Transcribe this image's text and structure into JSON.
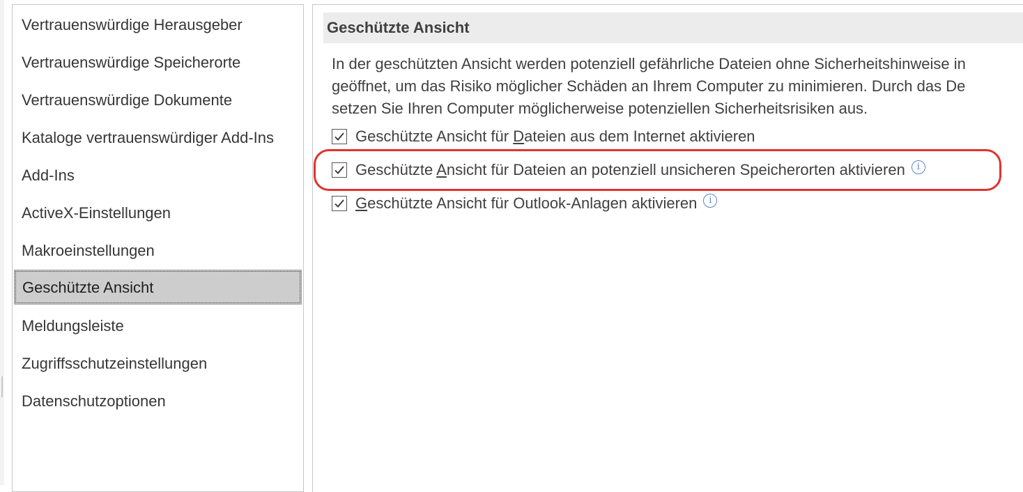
{
  "sidebar": {
    "items": [
      {
        "label": "Vertrauenswürdige Herausgeber",
        "selected": false
      },
      {
        "label": "Vertrauenswürdige Speicherorte",
        "selected": false
      },
      {
        "label": "Vertrauenswürdige Dokumente",
        "selected": false
      },
      {
        "label": "Kataloge vertrauenswürdiger Add-Ins",
        "selected": false
      },
      {
        "label": "Add-Ins",
        "selected": false
      },
      {
        "label": "ActiveX-Einstellungen",
        "selected": false
      },
      {
        "label": "Makroeinstellungen",
        "selected": false
      },
      {
        "label": "Geschützte Ansicht",
        "selected": true
      },
      {
        "label": "Meldungsleiste",
        "selected": false
      },
      {
        "label": "Zugriffsschutzeinstellungen",
        "selected": false
      },
      {
        "label": "Datenschutzoptionen",
        "selected": false
      }
    ]
  },
  "main": {
    "section_title": "Geschützte Ansicht",
    "description": [
      "In der geschützten Ansicht werden potenziell gefährliche Dateien ohne Sicherheitshinweise in",
      "geöffnet, um das Risiko möglicher Schäden an Ihrem Computer zu minimieren. Durch das De",
      "setzen Sie Ihren Computer möglicherweise potenziellen Sicherheitsrisiken aus."
    ],
    "options": [
      {
        "pre": "Geschützte Ansicht für ",
        "accel": "D",
        "post": "ateien aus dem Internet aktivieren",
        "checked": true,
        "info": false
      },
      {
        "pre": "Geschützte ",
        "accel": "A",
        "post": "nsicht für Dateien an potenziell unsicheren Speicherorten aktivieren",
        "checked": true,
        "info": true
      },
      {
        "pre": "",
        "accel": "G",
        "post": "eschützte Ansicht für Outlook-Anlagen aktivieren",
        "checked": true,
        "info": true
      }
    ],
    "info_icon": "info-icon",
    "highlight_color": "#e0332e"
  }
}
